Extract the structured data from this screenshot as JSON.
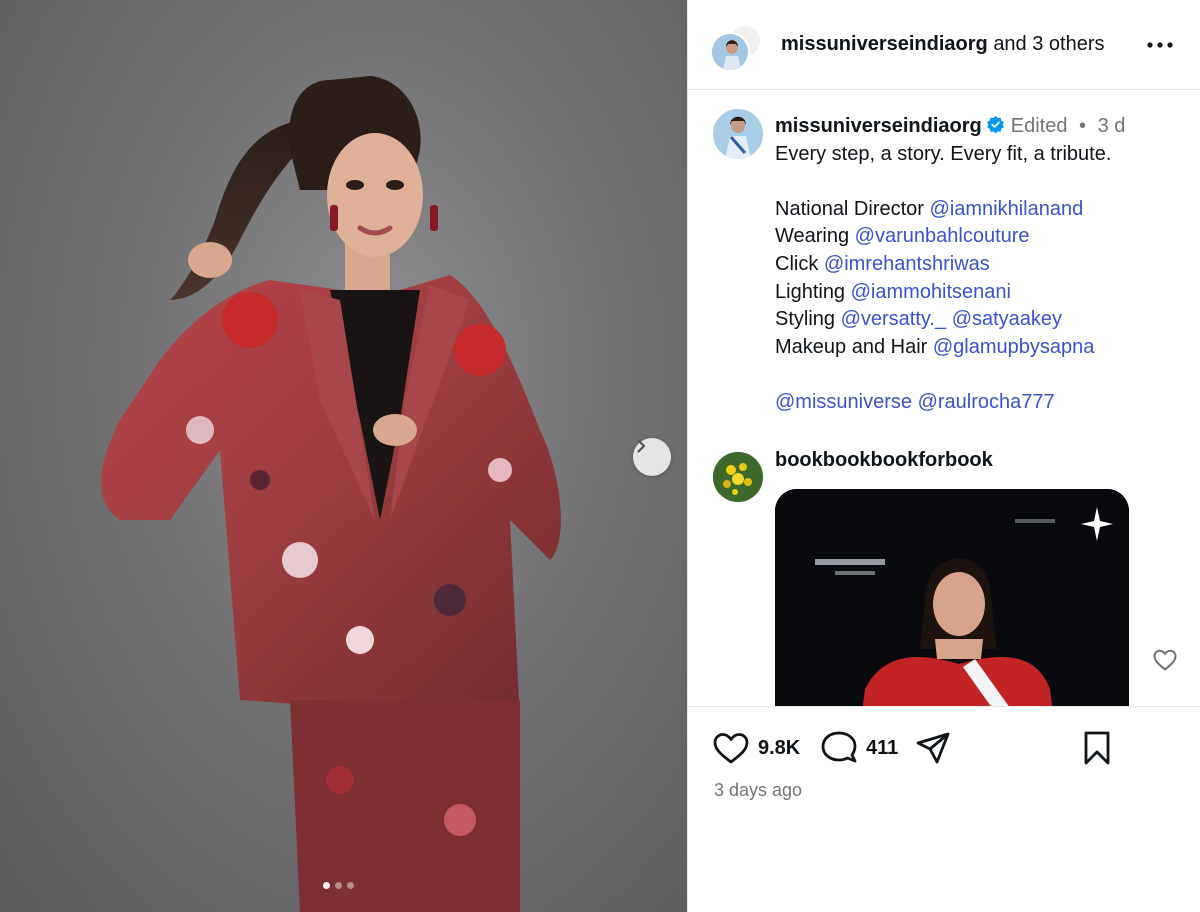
{
  "header": {
    "username": "missuniverseindiaorg",
    "others": "and 3 others"
  },
  "caption": {
    "username": "missuniverseindiaorg",
    "edited": "Edited",
    "separator": "•",
    "age": "3 d",
    "lines": {
      "intro": "Every step, a story. Every fit, a tribute.",
      "director_label": "National Director ",
      "director_handle": "@iamnikhilanand",
      "wearing_label": "Wearing ",
      "wearing_handle": "@varunbahlcouture",
      "click_label": "Click ",
      "click_handle": "@imrehantshriwas",
      "lighting_label": "Lighting ",
      "lighting_handle": "@iammohitsenani",
      "styling_label": "Styling ",
      "styling_handle1": "@versatty._",
      "styling_handle2": "@satyaakey",
      "makeup_label": "Makeup and Hair ",
      "makeup_handle": "@glamupbysapna",
      "tag1": "@missuniverse",
      "tag2": "@raulrocha777"
    }
  },
  "comment": {
    "username": "bookbookbookforbook"
  },
  "actions": {
    "likes": "9.8K",
    "comments": "411",
    "timestamp": "3 days ago"
  },
  "carousel": {
    "total_dots": 3,
    "active_dot": 1
  },
  "icons": {
    "more": "more-horizontal-icon",
    "verified": "verified-badge-icon",
    "like": "heart-icon",
    "comment": "comment-bubble-icon",
    "share": "paper-plane-icon",
    "save": "bookmark-icon",
    "next": "chevron-right-icon"
  },
  "colors": {
    "link": "#3a53c9",
    "verified": "#0095f6",
    "muted": "#737373"
  }
}
